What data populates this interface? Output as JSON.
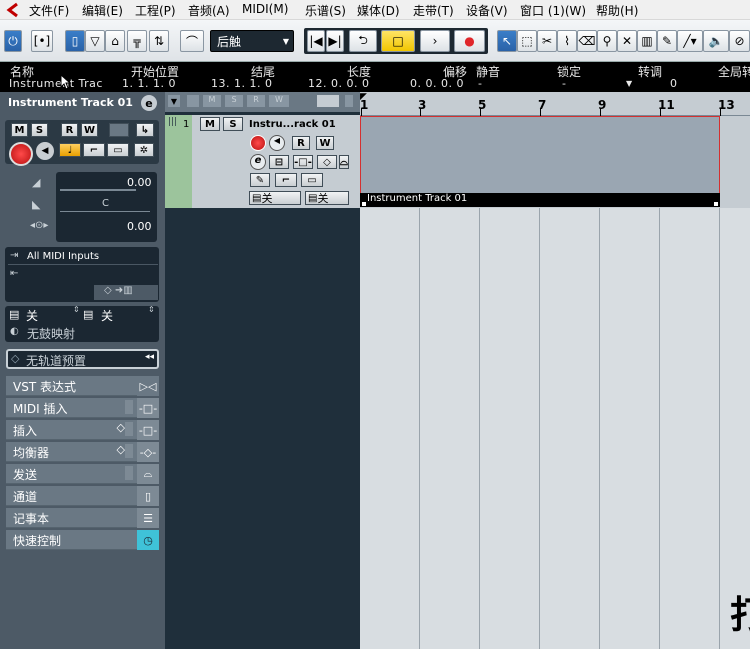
{
  "menubar": {
    "items": [
      "文件(F)",
      "编辑(E)",
      "工程(P)",
      "音频(A)",
      "MIDI(M)",
      "乐谱(S)",
      "媒体(D)",
      "走带(T)",
      "设备(V)",
      "窗口 (1)(W)",
      "帮助(H)"
    ]
  },
  "toolbar": {
    "automation_mode": "后触",
    "icons": [
      "power-icon",
      "snap-icon",
      "inspector-icon",
      "quantize-icon",
      "route-icon",
      "mixer-icon",
      "automation-icon",
      "go-start-icon",
      "go-end-icon",
      "loop-icon",
      "stop-icon",
      "play-icon",
      "record-icon",
      "pointer-icon",
      "range-icon",
      "split-icon",
      "glue-icon",
      "erase-icon",
      "zoom-icon",
      "mute-tool-icon",
      "comp-icon",
      "draw-icon",
      "line-icon",
      "speaker-icon",
      "audition-icon"
    ]
  },
  "infoline": {
    "headers": [
      "名称",
      "开始位置",
      "结尾",
      "长度",
      "偏移",
      "静音",
      "锁定",
      "转调",
      "全局转"
    ],
    "values": [
      "Instrument Trac",
      "1. 1. 1.   0",
      "13. 1. 1.   0",
      "12. 0. 0.   0",
      "0. 0. 0.   0",
      "-",
      "-",
      "0"
    ]
  },
  "inspector": {
    "track_name": "Instrument Track 01",
    "volume": "0.00",
    "pan": "C",
    "delay": "0.00",
    "midi_input": "All MIDI Inputs",
    "channel_label": "关",
    "bank_label": "关",
    "drum_map": "无鼓映射",
    "track_preset": "无轨道预置",
    "sections": [
      "VST 表达式",
      "MIDI 插入",
      "插入",
      "均衡器",
      "发送",
      "通道",
      "记事本",
      "快速控制"
    ]
  },
  "track": {
    "number": "1",
    "name": "Instru...rack 01",
    "route_label_1": "关",
    "route_label_2": "关"
  },
  "ruler": {
    "ticks": [
      "1",
      "3",
      "5",
      "7",
      "9",
      "11",
      "13"
    ]
  },
  "event": {
    "label": "Instrument Track 01"
  },
  "overlay_char": "打",
  "colors": {
    "accent_blue": "#2a62a8",
    "record_red": "#e0262a",
    "event_body": "#9aa6b2",
    "quick_control": "#3fc2d8"
  }
}
